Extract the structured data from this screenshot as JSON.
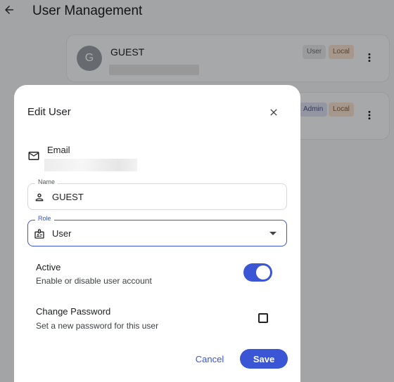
{
  "page": {
    "title": "User Management"
  },
  "users": [
    {
      "initial": "G",
      "name": "GUEST",
      "role_badge": "User",
      "source_badge": "Local"
    },
    {
      "initial": "",
      "name": "",
      "role_badge": "Admin",
      "source_badge": "Local"
    }
  ],
  "dialog": {
    "title": "Edit User",
    "email_label": "Email",
    "name_legend": "Name",
    "name_value": "GUEST",
    "role_legend": "Role",
    "role_value": "User",
    "active_label": "Active",
    "active_description": "Enable or disable user account",
    "active_enabled": true,
    "change_password_label": "Change Password",
    "change_password_description": "Set a new password for this user",
    "change_password_checked": false,
    "cancel_label": "Cancel",
    "save_label": "Save"
  },
  "colors": {
    "accent": "#3a56d4",
    "scrim": "rgba(0,0,0,0.33)"
  },
  "icons": [
    "back-arrow-icon",
    "more-vert-icon",
    "close-icon",
    "mail-icon",
    "person-icon",
    "badge-icon",
    "chevron-down-icon"
  ]
}
